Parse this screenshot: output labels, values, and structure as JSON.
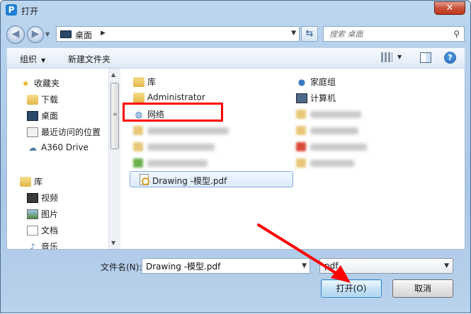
{
  "window": {
    "title": "打开",
    "app_icon_letter": "P",
    "close_glyph": "✕"
  },
  "navigation": {
    "back_glyph": "◀",
    "forward_glyph": "▶",
    "address_path": "桌面",
    "address_arrow_glyph": "▶",
    "refresh_glyph": "⇆"
  },
  "search": {
    "placeholder": "搜索 桌面",
    "icon": "search-icon"
  },
  "toolbar": {
    "organize_label": "组织",
    "new_folder_label": "新建文件夹",
    "help_glyph": "?"
  },
  "nav_pane": {
    "favorites": [
      {
        "label": "收藏夹",
        "icon": "star-icon"
      },
      {
        "label": "下载",
        "icon": "download-folder-icon"
      },
      {
        "label": "桌面",
        "icon": "desktop-icon"
      },
      {
        "label": "最近访问的位置",
        "icon": "recent-places-icon"
      },
      {
        "label": "A360 Drive",
        "icon": "cloud-drive-icon"
      }
    ],
    "libraries": [
      {
        "label": "库",
        "icon": "library-icon"
      },
      {
        "label": "视频",
        "icon": "video-icon"
      },
      {
        "label": "图片",
        "icon": "pictures-icon"
      },
      {
        "label": "文档",
        "icon": "documents-icon"
      },
      {
        "label": "音乐",
        "icon": "music-icon"
      }
    ]
  },
  "files": {
    "left_column": [
      {
        "label": "库",
        "icon": "library-folder-icon"
      },
      {
        "label": "Administrator",
        "icon": "user-folder-icon"
      },
      {
        "label": "网络",
        "icon": "network-icon"
      }
    ],
    "right_column": [
      {
        "label": "家庭组",
        "icon": "homegroup-icon"
      },
      {
        "label": "计算机",
        "icon": "computer-icon"
      }
    ],
    "selected": {
      "label": "Drawing -模型.pdf",
      "icon": "pdf-file-icon"
    }
  },
  "bottom": {
    "filename_label": "文件名(N):",
    "filename_value": "Drawing -模型.pdf",
    "filetype_value": "pdf",
    "open_label": "打开(O)",
    "cancel_label": "取消"
  },
  "colors": {
    "highlight_box": "#ff0000",
    "annotation_arrow": "#ff0000",
    "selection": "#dbeafc"
  }
}
